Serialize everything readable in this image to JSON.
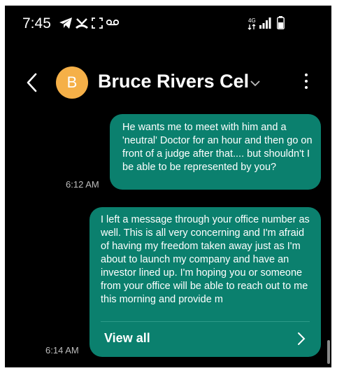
{
  "status_bar": {
    "time": "7:45",
    "left_icons": [
      "telegram-icon",
      "missed-call-icon",
      "screenshot-icon",
      "voicemail-icon"
    ],
    "right_icons": [
      "data-4g-icon",
      "signal-icon",
      "battery-icon"
    ]
  },
  "header": {
    "avatar_initial": "B",
    "avatar_color": "#f5b048",
    "contact_name": "Bruce Rivers Cel"
  },
  "messages": [
    {
      "text": "He wants me to meet with him and a 'neutral' Doctor for an hour and then go on front of a judge after that.... but shouldn't I be able to be represented by you?",
      "time": "6:12 AM"
    },
    {
      "text": "I left a message through your office number as well.  This is all very concerning and I'm afraid of having my freedom taken away just as I'm about to launch my company and have an investor lined up. I'm hoping you or someone from your office will be able to reach out to me this morning and provide m",
      "time": "6:14 AM",
      "view_all_label": "View all"
    }
  ],
  "colors": {
    "bubble": "#0b806e",
    "background": "#000000"
  }
}
